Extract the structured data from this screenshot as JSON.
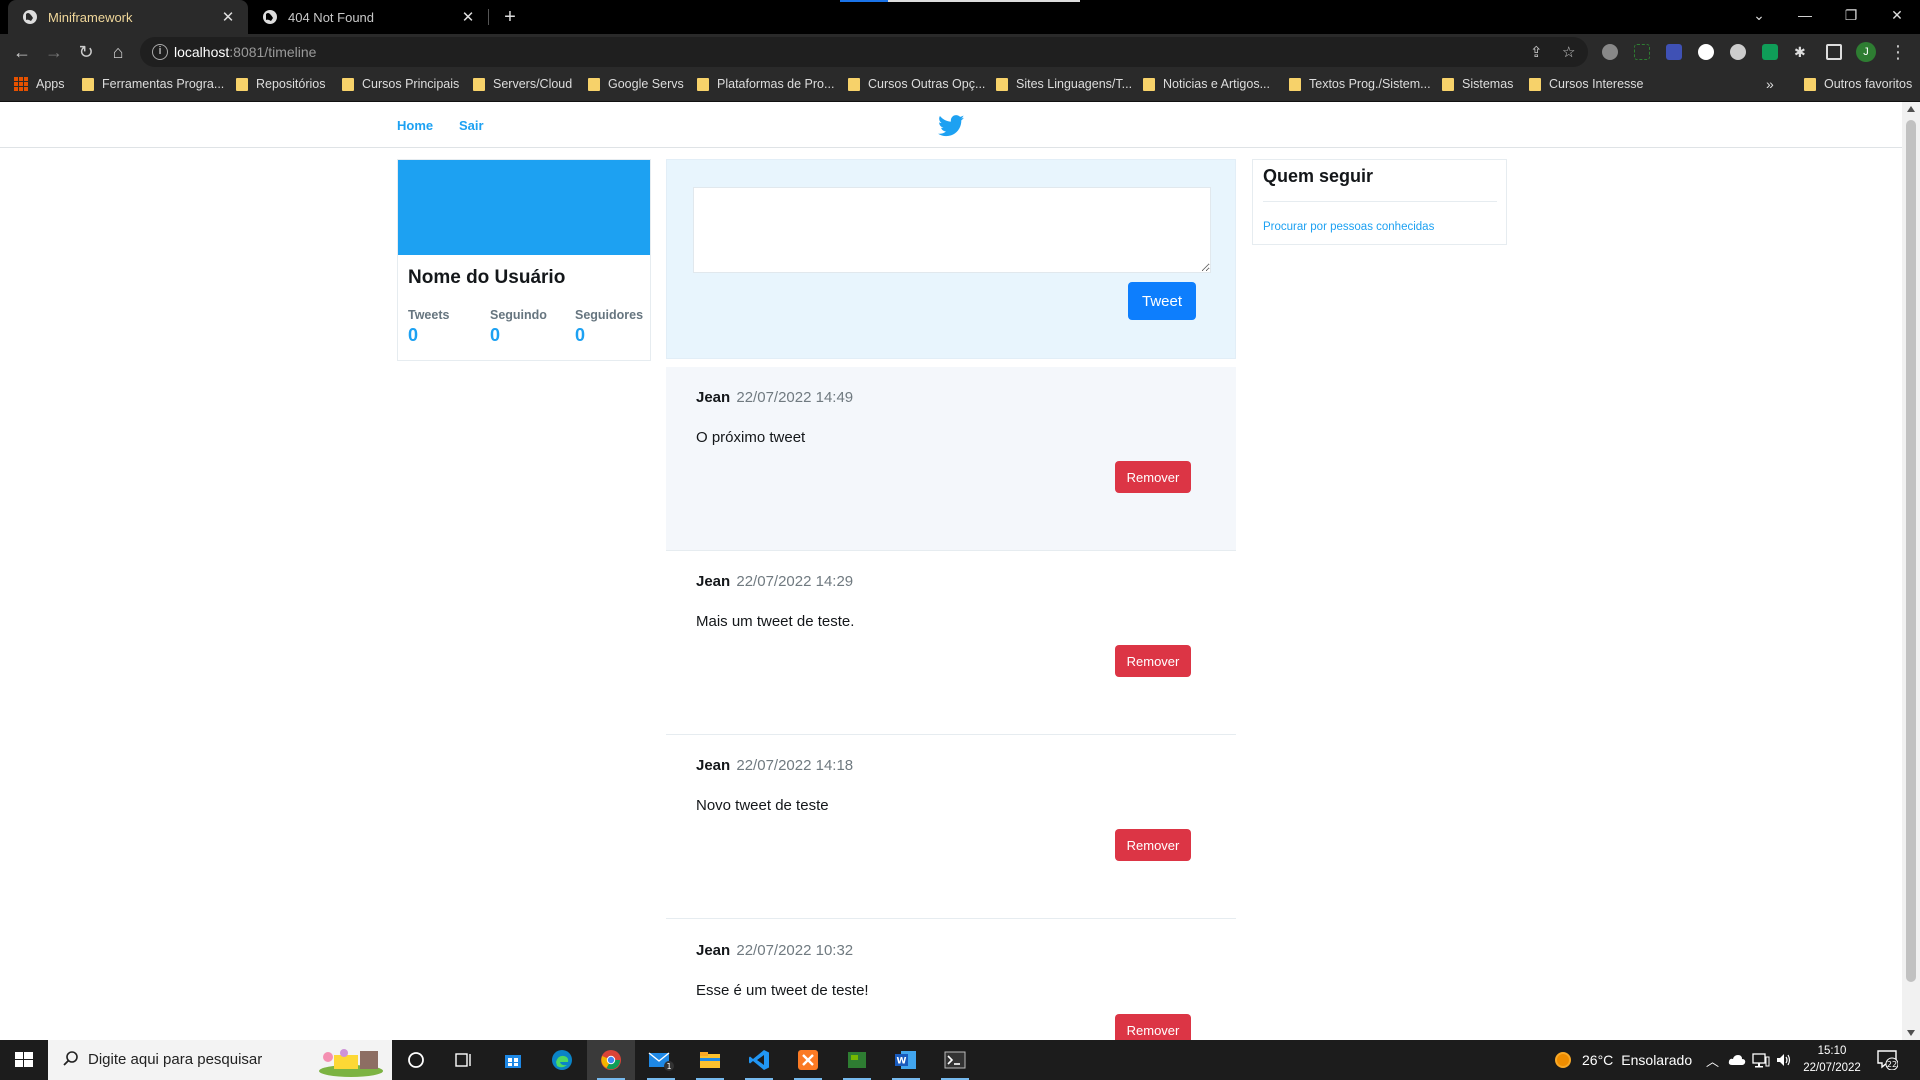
{
  "browser": {
    "tabs": [
      {
        "title": "Miniframework",
        "active": true
      },
      {
        "title": "404 Not Found",
        "active": false
      }
    ],
    "new_tab": "+",
    "url_host": "localhost",
    "url_path": ":8081/timeline",
    "profile_initial": "J",
    "bookmarks_more": "»",
    "bookmarks": [
      {
        "label": "Apps"
      },
      {
        "label": "Ferramentas Progra..."
      },
      {
        "label": "Repositórios"
      },
      {
        "label": "Cursos Principais"
      },
      {
        "label": "Servers/Cloud"
      },
      {
        "label": "Google Servs"
      },
      {
        "label": "Plataformas de Pro..."
      },
      {
        "label": "Cursos Outras Opç..."
      },
      {
        "label": "Sites Linguagens/T..."
      },
      {
        "label": "Noticias e Artigos..."
      },
      {
        "label": "Textos Prog./Sistem..."
      },
      {
        "label": "Sistemas"
      },
      {
        "label": "Cursos Interesse"
      },
      {
        "label": "Outros favoritos"
      }
    ]
  },
  "nav": {
    "home": "Home",
    "logout": "Sair"
  },
  "profile": {
    "name": "Nome do Usuário",
    "stats": [
      {
        "label": "Tweets",
        "value": "0"
      },
      {
        "label": "Seguindo",
        "value": "0"
      },
      {
        "label": "Seguidores",
        "value": "0"
      }
    ]
  },
  "composer": {
    "text": "",
    "button": "Tweet"
  },
  "tweets": [
    {
      "author": "Jean",
      "date": "22/07/2022 14:49",
      "text": "O próximo tweet",
      "action": "Remover"
    },
    {
      "author": "Jean",
      "date": "22/07/2022 14:29",
      "text": "Mais um tweet de teste.",
      "action": "Remover"
    },
    {
      "author": "Jean",
      "date": "22/07/2022 14:18",
      "text": "Novo tweet de teste",
      "action": "Remover"
    },
    {
      "author": "Jean",
      "date": "22/07/2022 10:32",
      "text": "Esse é um tweet de teste!",
      "action": "Remover"
    }
  ],
  "who_to_follow": {
    "title": "Quem seguir",
    "link": "Procurar por pessoas conhecidas"
  },
  "taskbar": {
    "search_placeholder": "Digite aqui para pesquisar",
    "weather_temp": "26°C",
    "weather_desc": "Ensolarado",
    "time": "15:10",
    "date": "22/07/2022",
    "notifications": "22",
    "mail_badge": "1"
  },
  "colors": {
    "brand": "#1da1f2",
    "tweet_button": "#0d7efd",
    "remove_button": "#dc3545",
    "composer_bg": "#e8f5fd"
  }
}
